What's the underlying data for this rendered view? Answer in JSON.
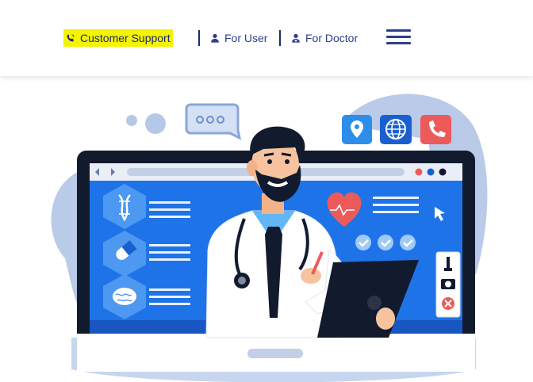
{
  "nav": {
    "customer_support": "Customer Support",
    "for_user": "For User",
    "for_doctor": "For Doctor",
    "menu_icon": "hamburger-menu-icon"
  },
  "icons": {
    "support": "phone-volume-icon",
    "user": "user-icon",
    "doctor": "user-doctor-icon"
  },
  "colors": {
    "primary": "#2c3f8f",
    "highlight": "#f4f300",
    "screen_blue": "#1f73e8",
    "accent_red": "#e84c4c"
  }
}
